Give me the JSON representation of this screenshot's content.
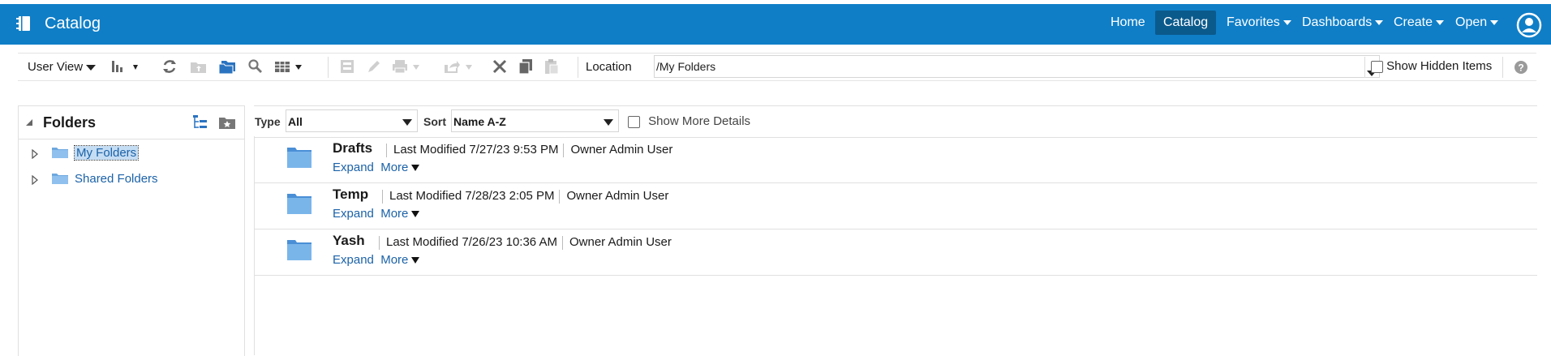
{
  "header": {
    "title": "Catalog",
    "nav": [
      {
        "label": "Home"
      },
      {
        "label": "Catalog",
        "active": true
      },
      {
        "label": "Favorites"
      },
      {
        "label": "Dashboards"
      },
      {
        "label": "Create"
      },
      {
        "label": "Open"
      }
    ],
    "color": "#0f7ec7"
  },
  "toolbar": {
    "view_label": "User View",
    "location_label": "Location",
    "location_value": "/My Folders",
    "show_hidden_label": "Show Hidden Items"
  },
  "left": {
    "title": "Folders",
    "tree": [
      {
        "label": "My Folders",
        "selected": true
      },
      {
        "label": "Shared Folders"
      }
    ]
  },
  "filter": {
    "type_label": "Type",
    "type_value": "All",
    "sort_label": "Sort",
    "sort_value": "Name A-Z",
    "more_details_label": "Show More Details"
  },
  "items": [
    {
      "name": "Drafts",
      "modified": "Last Modified 7/27/23 9:53 PM",
      "owner": "Owner Admin User",
      "expand": "Expand",
      "more": "More"
    },
    {
      "name": "Temp",
      "modified": "Last Modified 7/28/23 2:05 PM",
      "owner": "Owner Admin User",
      "expand": "Expand",
      "more": "More"
    },
    {
      "name": "Yash",
      "modified": "Last Modified 7/26/23 10:36 AM",
      "owner": "Owner Admin User",
      "expand": "Expand",
      "more": "More"
    }
  ]
}
